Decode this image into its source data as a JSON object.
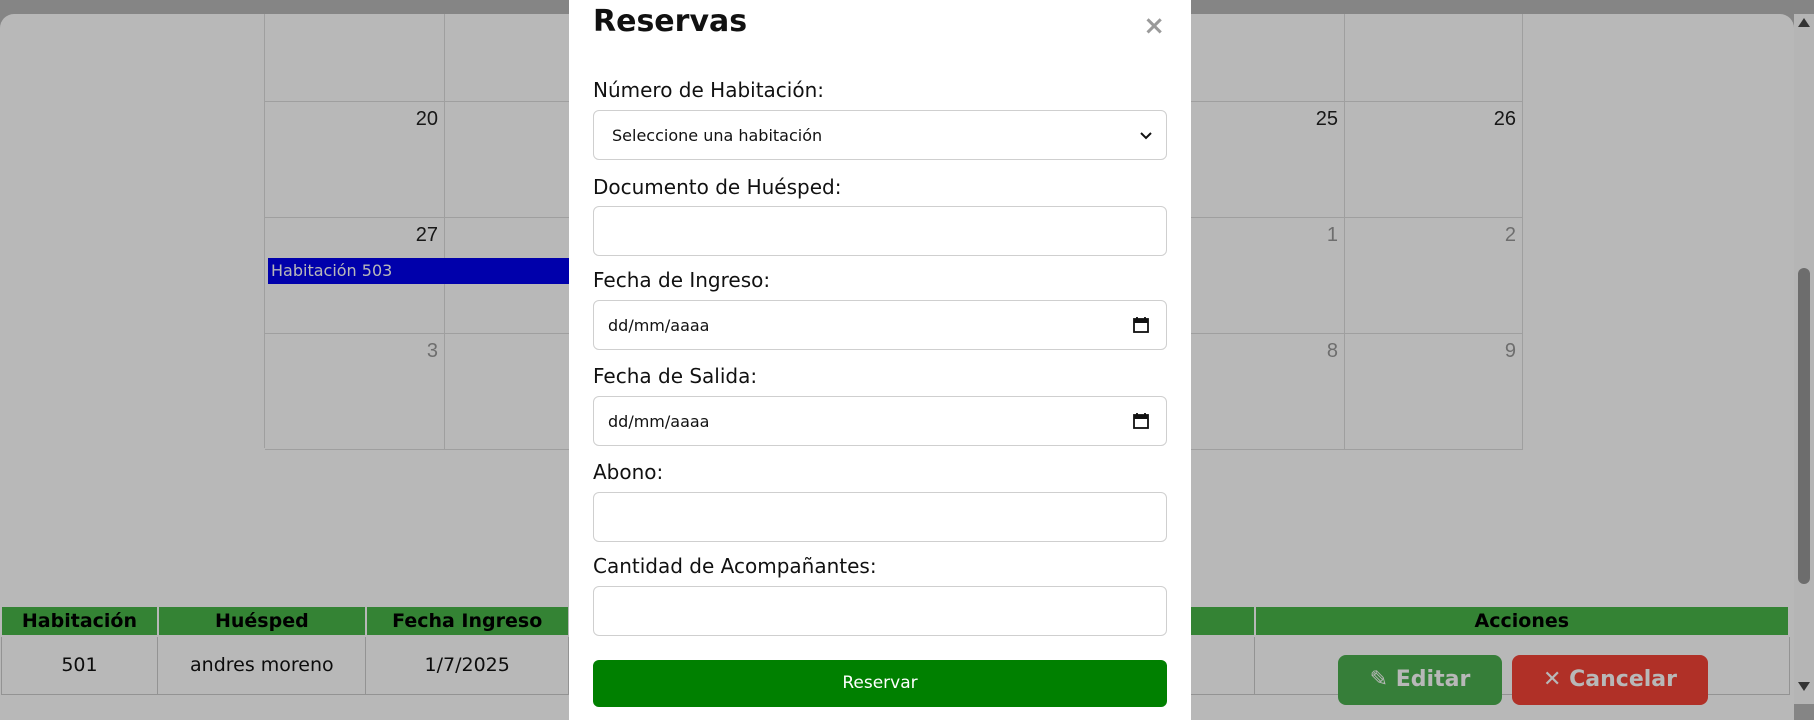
{
  "calendar": {
    "rows": [
      [
        "",
        "",
        "",
        "",
        "",
        "",
        ""
      ],
      [
        "20",
        "",
        "",
        "",
        "",
        "25",
        "26"
      ],
      [
        "27",
        "",
        "",
        "",
        "",
        "1",
        "2"
      ],
      [
        "3",
        "",
        "",
        "",
        "",
        "8",
        "9"
      ]
    ],
    "event_label": "Habitación 503"
  },
  "table": {
    "headers": [
      "Habitación",
      "Huésped",
      "Fecha Ingreso",
      "",
      "",
      "Acciones"
    ],
    "row": [
      "501",
      "andres moreno",
      "1/7/2025",
      "",
      "",
      ""
    ]
  },
  "actions": {
    "edit_label": "Editar",
    "edit_icon": "pencil-icon",
    "cancel_label": "Cancelar",
    "cancel_icon": "x-icon"
  },
  "modal": {
    "title": "Reservas",
    "close_symbol": "×",
    "room_label": "Número de Habitación:",
    "room_value": "Seleccione una habitación",
    "guest_doc_label": "Documento de Huésped:",
    "guest_doc_value": "",
    "check_in_label": "Fecha de Ingreso:",
    "check_in_value": "dd/mm/aaaa",
    "check_out_label": "Fecha de Salida:",
    "check_out_value": "dd/mm/aaaa",
    "deposit_label": "Abono:",
    "deposit_value": "",
    "companions_label": "Cantidad de Acompañantes:",
    "companions_value": "",
    "submit_label": "Reservar"
  },
  "colors": {
    "submit_green": "#008000",
    "edit_green": "#4caf50",
    "cancel_red": "#f44336",
    "event_blue": "#0000ee",
    "table_header_green": "#49b649"
  }
}
